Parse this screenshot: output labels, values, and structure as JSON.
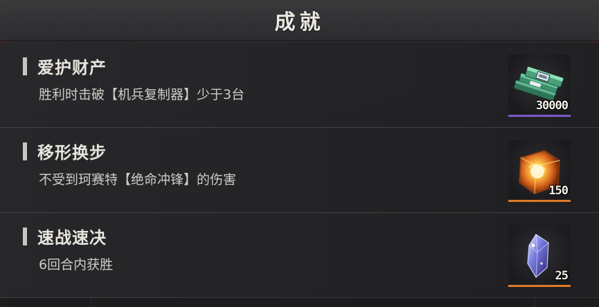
{
  "header": {
    "title": "成就"
  },
  "achievements": [
    {
      "name": "爱护财产",
      "description": "胜利时击破【机兵复制器】少于3台",
      "reward": {
        "icon": "cash-stack-icon",
        "count": "30000",
        "accent": "#7a5cc7"
      }
    },
    {
      "name": "移形换步",
      "description": "不受到珂赛特【绝命冲锋】的伤害",
      "reward": {
        "icon": "glowing-cube-icon",
        "count": "150",
        "accent": "#e07a2a"
      }
    },
    {
      "name": "速战速决",
      "description": "6回合内获胜",
      "reward": {
        "icon": "crystal-shard-icon",
        "count": "25",
        "accent": "#e07a2a"
      }
    }
  ]
}
